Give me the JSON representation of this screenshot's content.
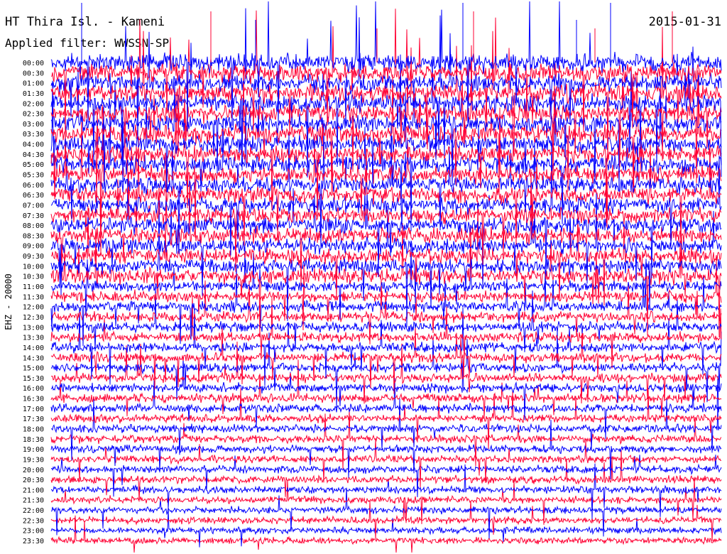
{
  "header": {
    "station": "HT Thira Isl. - Kameni",
    "date": "2015-01-31",
    "filter": "Applied filter: WWSSN-SP"
  },
  "chart_data": {
    "type": "line",
    "channel_label": "EHZ - 20000",
    "rows": [
      "00:00",
      "00:30",
      "01:00",
      "01:30",
      "02:00",
      "02:30",
      "03:00",
      "03:30",
      "04:00",
      "04:30",
      "05:00",
      "05:30",
      "06:00",
      "06:30",
      "07:00",
      "07:30",
      "08:00",
      "08:30",
      "09:00",
      "09:30",
      "10:00",
      "10:30",
      "11:00",
      "11:30",
      "12:00",
      "12:30",
      "13:00",
      "13:30",
      "14:00",
      "14:30",
      "15:00",
      "15:30",
      "16:00",
      "16:30",
      "17:00",
      "17:30",
      "18:00",
      "18:30",
      "19:00",
      "19:30",
      "20:00",
      "20:30",
      "21:00",
      "21:30",
      "22:00",
      "22:30",
      "23:00",
      "23:30"
    ],
    "series_colors": [
      "#0000ff",
      "#ff0033"
    ],
    "grid": false
  }
}
